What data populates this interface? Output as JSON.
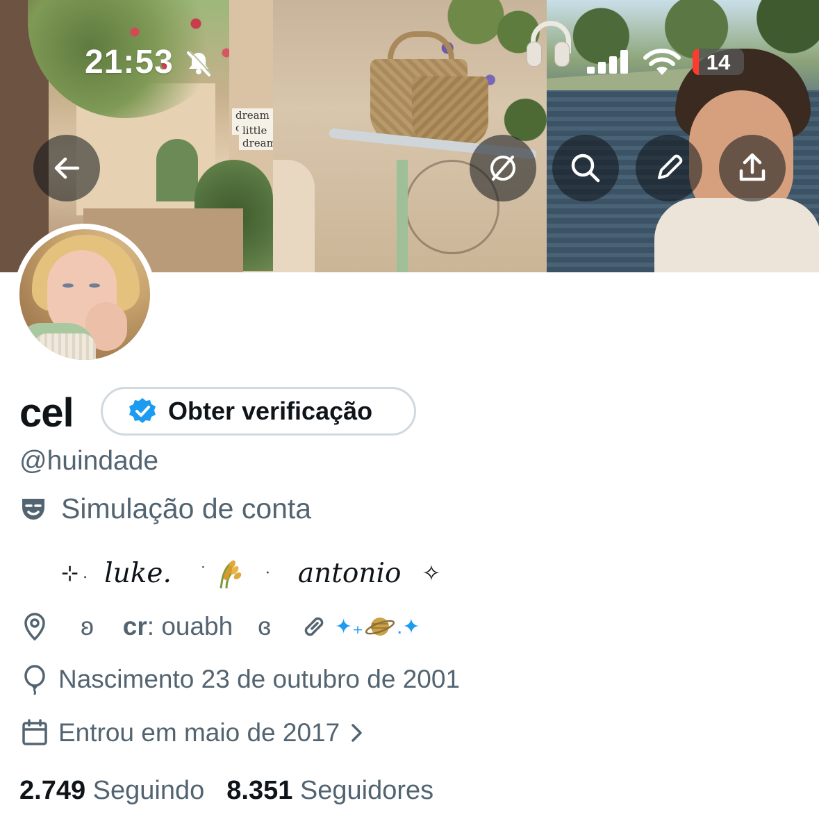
{
  "status_bar": {
    "time": "21:53",
    "battery": "14",
    "icons": [
      "bell-slash-icon",
      "cellular-signal-icon",
      "wifi-icon",
      "battery-icon"
    ]
  },
  "banner": {
    "caption_line1": "dream on",
    "caption_line2": "little dreamer",
    "buttons": [
      "back-arrow-icon",
      "hide-icon",
      "search-icon",
      "edit-pencil-icon",
      "share-icon"
    ]
  },
  "profile": {
    "name": "cel",
    "verify_label": "Obter verificação",
    "handle": "@huindade",
    "label_text": "Simulação de conta",
    "bio": {
      "lead_sparkle": "⊹",
      "lead_dot": ".",
      "name1": "luke.",
      "mid_dot1": "˙",
      "mid_dot2": "·",
      "name2": "antonio",
      "end_sparkle": "✧"
    },
    "location": {
      "prefix": "ʚ",
      "cr_label": "cr",
      "cr_value": ": ouabh",
      "suffix": "ɞ"
    },
    "link": {
      "left": "✦₊",
      "right": ".✦"
    },
    "birth": "Nascimento 23 de outubro de 2001",
    "joined": "Entrou em maio de 2017"
  },
  "stats": {
    "following_count": "2.749",
    "following_label": "Seguindo",
    "followers_count": "8.351",
    "followers_label": "Seguidores"
  },
  "colors": {
    "accent": "#1d9bf0",
    "secondary_text": "#536471",
    "primary_text": "#0f1419",
    "border": "#cfd9de"
  }
}
